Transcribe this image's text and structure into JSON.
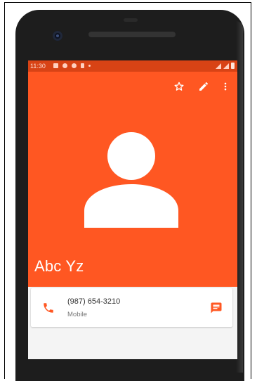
{
  "statusbar": {
    "time": "11:30"
  },
  "header": {
    "contact_name": "Abc Yz",
    "actions": [
      {
        "icon": "star-outline-icon"
      },
      {
        "icon": "edit-pencil-icon"
      },
      {
        "icon": "more-vertical-icon"
      }
    ]
  },
  "phone_entry": {
    "number": "(987) 654-3210",
    "type": "Mobile",
    "icon": "phone-icon",
    "action_icon": "message-icon"
  },
  "colors": {
    "accent": "#ff5722",
    "statusbar": "#d84315",
    "icon_accent": "#ff5722"
  }
}
